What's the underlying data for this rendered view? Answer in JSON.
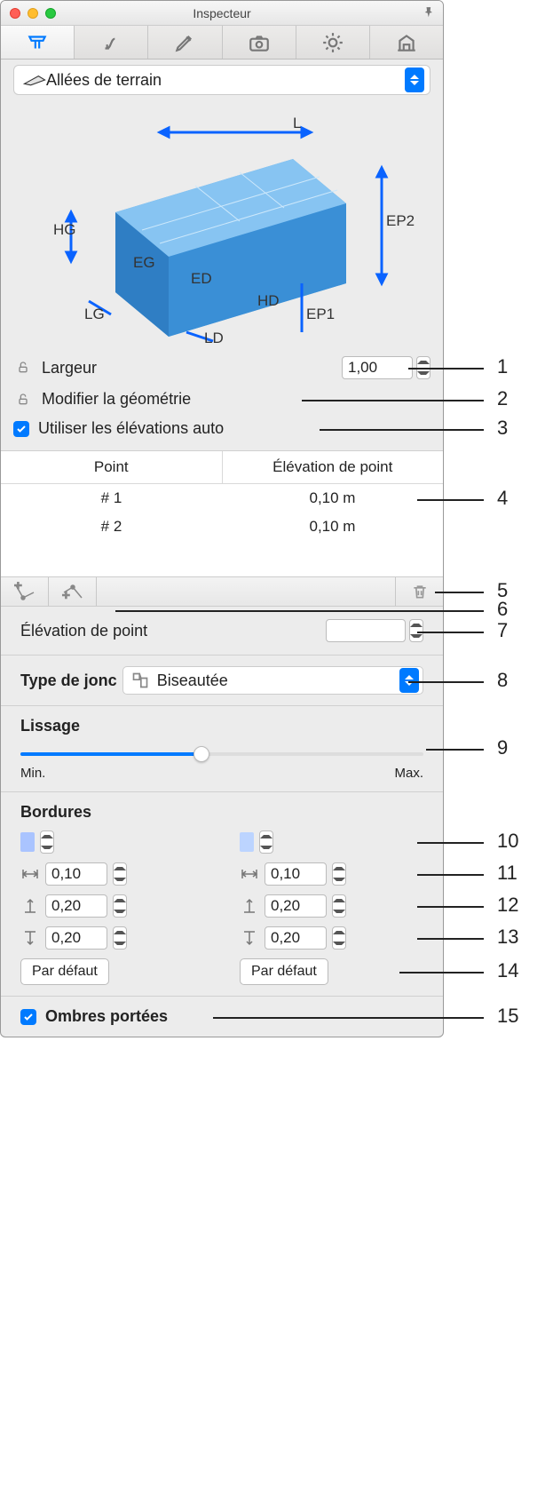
{
  "window": {
    "title": "Inspecteur"
  },
  "type_selector": {
    "label": "Allées de terrain"
  },
  "diagram": {
    "labels": {
      "L": "L",
      "EP1": "EP1",
      "EP2": "EP2",
      "HG": "HG",
      "LG": "LG",
      "EG": "EG",
      "ED": "ED",
      "HD": "HD",
      "LD": "LD"
    }
  },
  "width": {
    "label": "Largeur",
    "value": "1,00"
  },
  "modify_geom": {
    "label": "Modifier la géométrie"
  },
  "auto_elev": {
    "label": "Utiliser les élévations auto",
    "checked": true
  },
  "points_table": {
    "head": [
      "Point",
      "Élévation de point"
    ],
    "rows": [
      {
        "point": "# 1",
        "elev": "0,10 m"
      },
      {
        "point": "# 2",
        "elev": "0,10 m"
      }
    ]
  },
  "point_elev": {
    "label": "Élévation de point",
    "value": ""
  },
  "joint_type": {
    "label": "Type de jonc",
    "value": "Biseautée"
  },
  "smoothing": {
    "label": "Lissage",
    "min": "Min.",
    "max": "Max."
  },
  "borders": {
    "label": "Bordures",
    "left": {
      "w": "0,10",
      "hu": "0,20",
      "hd": "0,20",
      "default": "Par défaut"
    },
    "right": {
      "w": "0,10",
      "hu": "0,20",
      "hd": "0,20",
      "default": "Par défaut"
    }
  },
  "shadows": {
    "label": "Ombres portées",
    "checked": true
  },
  "callouts": [
    "1",
    "2",
    "3",
    "4",
    "5",
    "6",
    "7",
    "8",
    "9",
    "10",
    "11",
    "12",
    "13",
    "14",
    "15"
  ]
}
